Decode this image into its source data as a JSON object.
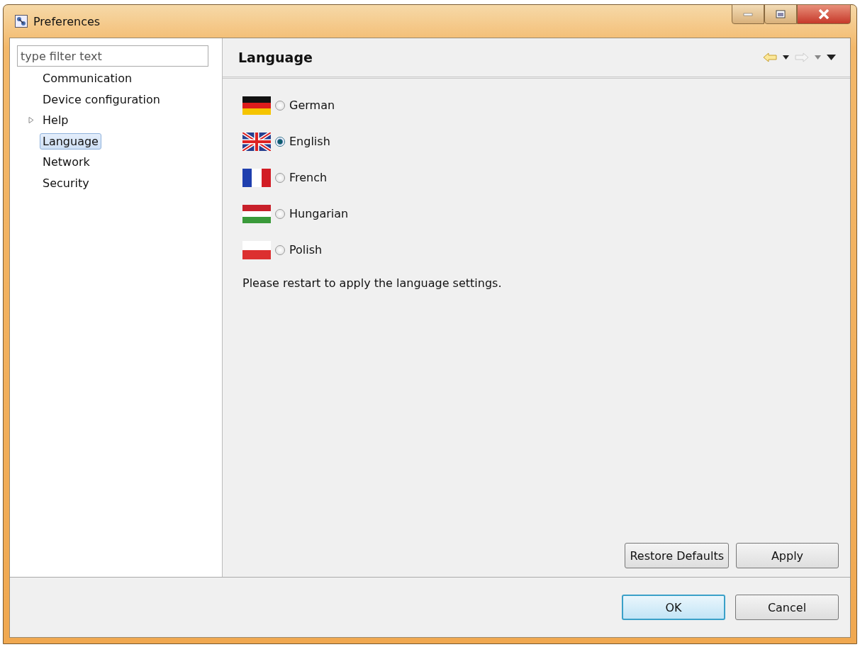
{
  "window": {
    "title": "Preferences"
  },
  "filter": {
    "placeholder": "type filter text"
  },
  "tree": [
    {
      "label": "Communication",
      "selected": false
    },
    {
      "label": "Device configuration",
      "selected": false
    },
    {
      "label": "Help",
      "selected": false,
      "expanded": false
    },
    {
      "label": "Language",
      "selected": true
    },
    {
      "label": "Network",
      "selected": false
    },
    {
      "label": "Security",
      "selected": false
    }
  ],
  "page": {
    "title": "Language",
    "languages": [
      {
        "kind": "de",
        "label": "German",
        "selected": false
      },
      {
        "kind": "gb",
        "label": "English",
        "selected": true
      },
      {
        "kind": "fr",
        "label": "French",
        "selected": false
      },
      {
        "kind": "hu",
        "label": "Hungarian",
        "selected": false
      },
      {
        "kind": "pl",
        "label": "Polish",
        "selected": false
      }
    ],
    "note": "Please restart to apply the language settings.",
    "buttons": [
      "Restore Defaults",
      "Apply"
    ]
  },
  "dialog_buttons": [
    {
      "label": "OK",
      "default": true
    },
    {
      "label": "Cancel",
      "default": false
    }
  ]
}
